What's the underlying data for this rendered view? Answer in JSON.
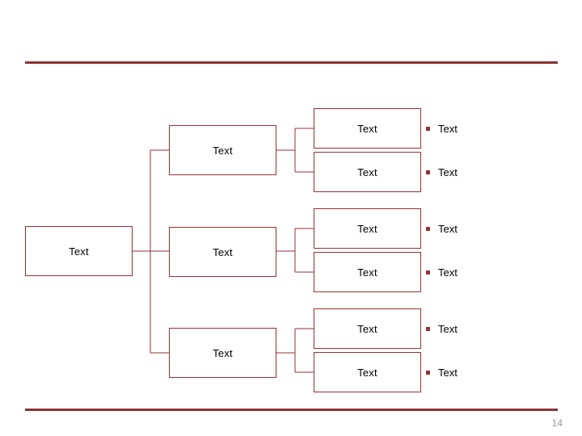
{
  "slide": {
    "page_number": "14",
    "accent_color": "#963134",
    "rule_color": "#8C3134",
    "text_color": "#000000",
    "page_number_color": "#9a9a9a",
    "background": "#ffffff"
  },
  "diagram": {
    "type": "org-tree",
    "levels": 3,
    "root": {
      "label": "Text"
    },
    "level2": [
      {
        "label": "Text"
      },
      {
        "label": "Text"
      },
      {
        "label": "Text"
      }
    ],
    "level3": [
      {
        "label": "Text"
      },
      {
        "label": "Text"
      },
      {
        "label": "Text"
      },
      {
        "label": "Text"
      },
      {
        "label": "Text"
      },
      {
        "label": "Text"
      }
    ],
    "annotations": [
      {
        "label": "Text"
      },
      {
        "label": "Text"
      },
      {
        "label": "Text"
      },
      {
        "label": "Text"
      },
      {
        "label": "Text"
      },
      {
        "label": "Text"
      }
    ]
  }
}
